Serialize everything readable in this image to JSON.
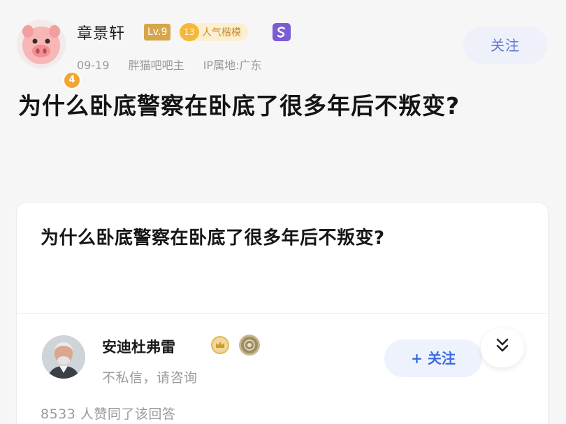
{
  "post": {
    "author": "章景轩",
    "level": "Lv.9",
    "badge_count": "13",
    "badge_label": "人气楷模",
    "date": "09-19",
    "role": "胖猫吧吧主",
    "ip_location": "IP属地:广东",
    "follow_label": "关注",
    "avatar_badge": "4",
    "title": "为什么卧底警察在卧底了很多年后不叛变?"
  },
  "card": {
    "title": "为什么卧底警察在卧底了很多年后不叛变?",
    "answerer_name": "安迪杜弗雷",
    "answerer_note": "不私信，请咨询",
    "follow_label": "+ 关注",
    "agree_text": "8533 人赞同了该回答"
  },
  "colors": {
    "accent": "#5a78d6",
    "follow_bg": "#eef1fa",
    "level_badge": "#d6a64b",
    "popularity_badge": "#f5b83a",
    "purple_badge": "#7b5cd6"
  },
  "icons": {
    "avatar": "pig-face-icon",
    "badge_extra": "s-badge-icon",
    "answerer_badge_1": "crown-icon",
    "answerer_badge_2": "medal-icon",
    "expand": "double-chevron-down-icon"
  }
}
